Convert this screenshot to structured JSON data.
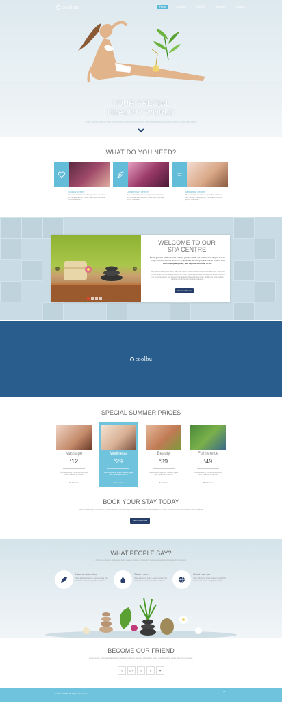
{
  "brand": {
    "logo": "coolbu"
  },
  "nav": {
    "items": [
      {
        "label": "Home",
        "active": true
      },
      {
        "label": "About us",
        "active": false
      },
      {
        "label": "Our SPA",
        "active": false
      },
      {
        "label": "Services",
        "active": false
      },
      {
        "label": "Location",
        "active": false
      }
    ]
  },
  "hero": {
    "title_line1": "YOUR SPECIAL",
    "title_line2": "HEALTHY WORLD",
    "subtitle": "Proin gravida nibh vel velit auctor aliquet. Aenean sollicitudin, lorem quis bibendum auctor, nisi elit consequat ipsum"
  },
  "needs": {
    "title": "WHAT DO YOU NEED?",
    "items": [
      {
        "name": "Beauty centre",
        "icon": "heart-icon",
        "text": "Duis sed odio sit amet. Suspendisse sit amet orci feugiat, auctor ipsum. Nam quis nisl pede ipsum bibendum."
      },
      {
        "name": "Gentleman centre",
        "icon": "leaf-icon",
        "text": "Duis sed odio sit amet. Suspendisse sit amet orci feugiat, auctor ipsum. Nam quis nisl pede ipsum bibendum."
      },
      {
        "name": "Massage centre",
        "icon": "waves-icon",
        "text": "Duis sed odio sit amet. Suspendisse sit amet orci feugiat, auctor ipsum. Nam quis nisl pede ipsum bibendum."
      }
    ]
  },
  "welcome": {
    "title_line1": "WELCOME TO OUR",
    "title_line2": "SPA CENTRE",
    "bold_text": "Proin gravida nibh vel velit a Proin gravida nibh vel velit auctor aliquet Aenea tempore anim aliquet. Aenean sollicitudin, lorem quis bibendum auctor, nisi elit consequat ipsum, nec sagittis sem nibh id elit.",
    "text": "Morbi accumsan ipsum velit. Nam nec tellus a odio tincidunt auctor a ornare odio. Sed non mauris vitae erat consequat auctor eu in elit. Class aptent taciti sociosqu ad litora torquent per conubia nostra, per inceptos himenaeos. Mauris in erat justo. Nullam ac urna eu felis dapibus condimentum sit amet a augue.",
    "button": "Inform with love"
  },
  "band": {
    "logo": "coolbu"
  },
  "prices": {
    "title": "SPECIAL SUMMER PRICES",
    "currency": "$",
    "items": [
      {
        "name": "Massage",
        "price": "12",
        "text": "Vitae adipiscing turpis. Aenean ligula nibh, molestie id viverra.",
        "more": "Read more",
        "highlight": false
      },
      {
        "name": "Wellness",
        "price": "29",
        "text": "Vitae adipiscing turpis. Aenean ligula nibh, molestie id viverra.",
        "more": "Read more",
        "highlight": true
      },
      {
        "name": "Beauty",
        "price": "39",
        "text": "Vitae adipiscing turpis. Aenean ligula nibh, molestie id viverra.",
        "more": "Read more",
        "highlight": false
      },
      {
        "name": "Full service",
        "price": "49",
        "text": "Vitae adipiscing turpis. Aenean ligula nibh, molestie id viverra.",
        "more": "Read more",
        "highlight": false
      }
    ]
  },
  "book": {
    "title": "BOOK YOUR STAY TODAY",
    "text": "Maecenas tristique orci ac sem. Duis ultricies pharetra magna. Donec accumsan malesuada orci. Donec sit amet eros. Lorem ipsum dolor sit amet.",
    "button": "Inform with love"
  },
  "testimonials": {
    "title": "WHAT PEOPLE SAY?",
    "subtitle": "Aenean commodo ligula eget dolor. Aenean massa. Cum sociis natoque penatibus et magnis dis parturient.",
    "items": [
      {
        "name": "Natural cosmetics",
        "icon": "leaf-icon",
        "text": "Vitae adipiscing turpis. Aenean ligula nibh, molestie id viverra a, dapibus at dolor."
      },
      {
        "name": "Steam room",
        "icon": "drop-icon",
        "text": "Vitae adipiscing turpis. Aenean ligula nibh, molestie id viverra a, dapibus at dolor."
      },
      {
        "name": "World mar ruo",
        "icon": "globe-icon",
        "text": "Vitae adipiscing turpis. Aenean ligula nibh, molestie id viverra a, dapibus at dolor."
      }
    ]
  },
  "friend": {
    "title": "BECOME OUR FRIEND",
    "text": "Lorem ipsum proin gravida nibh vel velit auctor aliquet. Aenean sollicitudin, lorem quis bibendum auctor, nisi elit consequat.",
    "social": [
      {
        "label": "f",
        "icon": "facebook-icon"
      },
      {
        "label": "G+",
        "icon": "google-plus-icon"
      },
      {
        "label": "t",
        "icon": "twitter-icon"
      },
      {
        "label": "v",
        "icon": "vimeo-icon"
      },
      {
        "label": "✦",
        "icon": "pinterest-icon"
      }
    ]
  },
  "footer": {
    "copyright": "Coolbu © 2015 All Rights Reserved"
  },
  "colors": {
    "accent": "#63bcd8",
    "band": "#285d8d",
    "button": "#283e6a"
  }
}
